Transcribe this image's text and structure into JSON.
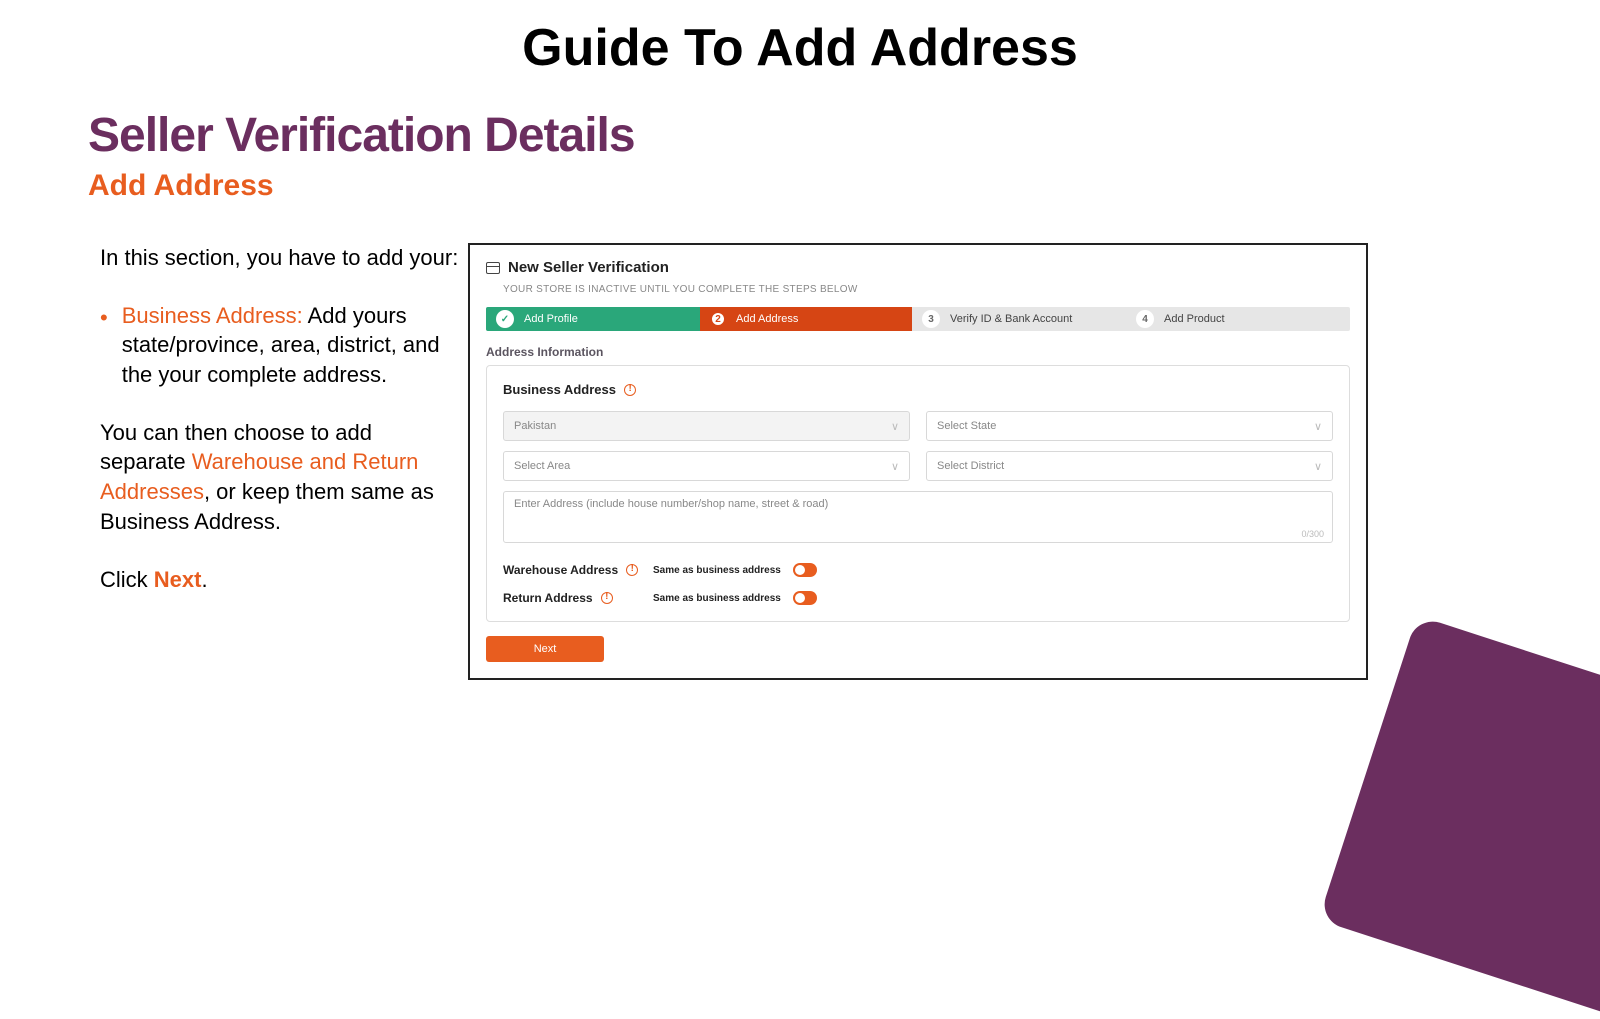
{
  "page_title": "Guide To Add Address",
  "section_title": "Seller Verification Details",
  "sub_title": "Add Address",
  "left": {
    "intro": "In this section, you have to add your:",
    "bullet_label": "Business Address:",
    "bullet_text": " Add yours state/province, area, district, and the your complete address.",
    "p2_a": "You can then choose to add separate ",
    "p2_b": "Warehouse and Return Addresses",
    "p2_c": ", or keep them same as Business Address.",
    "p3_a": "Click ",
    "p3_b": "Next",
    "p3_c": "."
  },
  "panel": {
    "title": "New Seller Verification",
    "subtitle": "YOUR STORE IS INACTIVE UNTIL YOU COMPLETE THE STEPS BELOW",
    "steps": {
      "s1": "Add Profile",
      "s2": "Add Address",
      "s3": "Verify ID & Bank Account",
      "s4": "Add Product",
      "n2": "2",
      "n3": "3",
      "n4": "4"
    },
    "section_label": "Address Information",
    "card_title": "Business Address",
    "country": "Pakistan",
    "select_state": "Select State",
    "select_area": "Select Area",
    "select_district": "Select District",
    "address_placeholder": "Enter Address (include house number/shop name, street & road)",
    "char_count": "0/300",
    "warehouse_label": "Warehouse Address",
    "return_label": "Return Address",
    "same_as": "Same as business address",
    "next": "Next"
  }
}
